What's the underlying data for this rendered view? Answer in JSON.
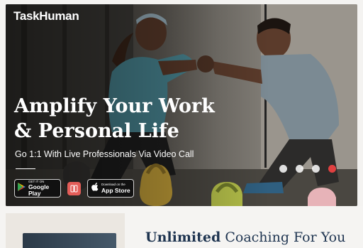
{
  "brand": {
    "logo_text": "TaskHuman"
  },
  "hero": {
    "headline_line1": "Amplify Your Work",
    "headline_line2": "& Personal Life",
    "subheadline": "Go 1:1 With Live Professionals Via Video Call",
    "google_play": {
      "small": "GET IT ON",
      "big": "Google Play"
    },
    "app_store": {
      "small": "Download on the",
      "big": "App Store"
    },
    "call_controls": [
      "camera-control",
      "mic-control",
      "flip-control",
      "end-call-control"
    ]
  },
  "section": {
    "title_strong": "Unlimited",
    "title_rest": " Coaching For You"
  },
  "colors": {
    "headline": "#ffffff",
    "section_title": "#1e3450",
    "end_call": "#e04040",
    "app_icon": "#e35d58"
  }
}
